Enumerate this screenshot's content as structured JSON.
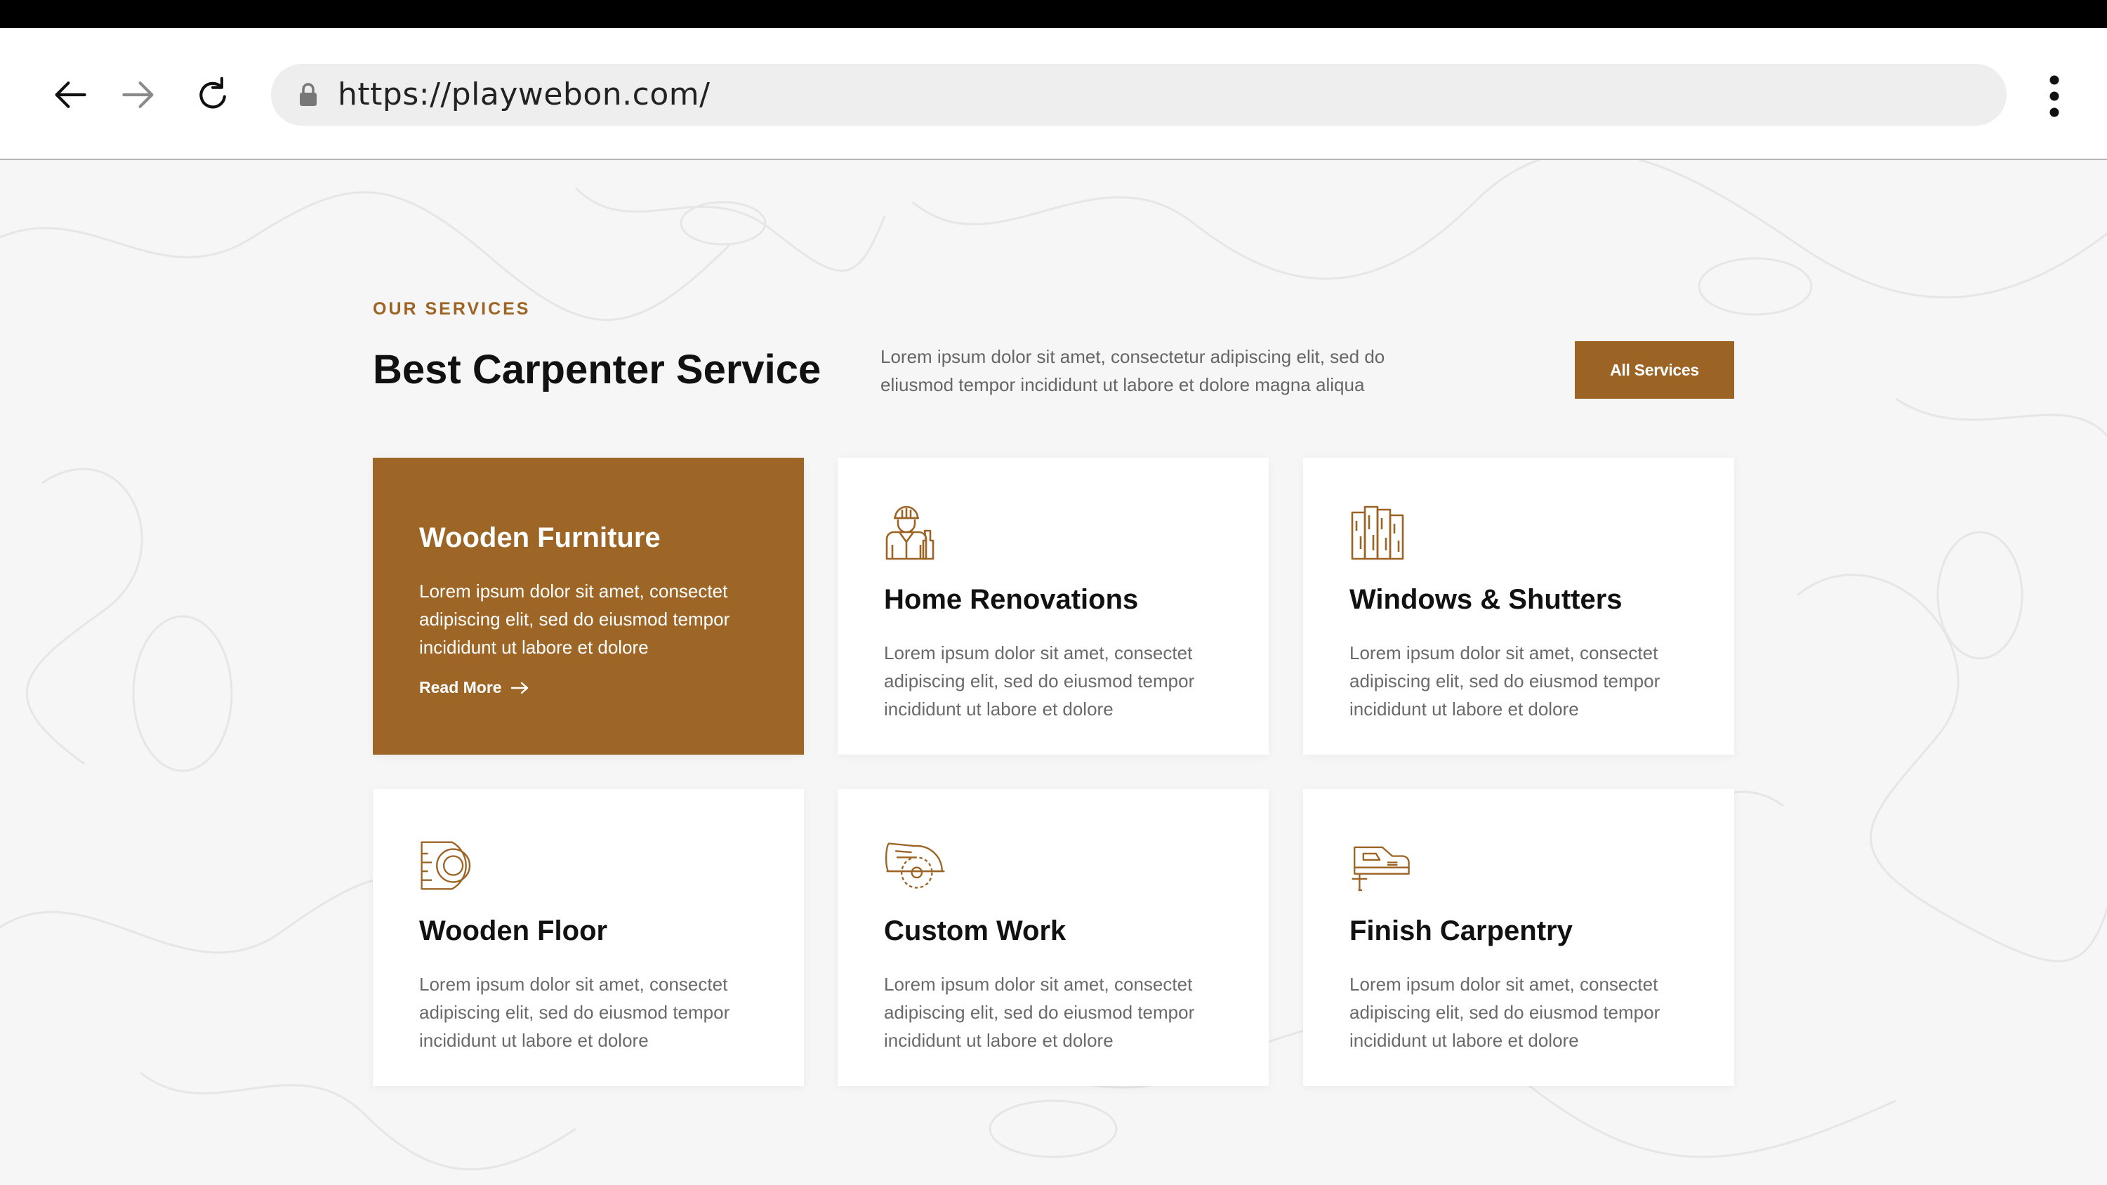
{
  "browser": {
    "url": "https://playwebon.com/"
  },
  "section": {
    "eyebrow": "OUR SERVICES",
    "heading": "Best Carpenter Service",
    "intro": "Lorem ipsum dolor sit amet, consectetur adipiscing elit, sed do eliusmod tempor incididunt ut labore et dolore magna aliqua",
    "button_label": "All Services"
  },
  "services": [
    {
      "title": "Wooden Furniture",
      "description": "Lorem ipsum dolor sit amet, consectet adipiscing elit, sed do eiusmod tempor incididunt ut labore et dolore",
      "link_label": "Read More",
      "highlighted": true
    },
    {
      "title": "Home Renovations",
      "description": "Lorem ipsum dolor sit amet, consectet adipiscing elit, sed do eiusmod tempor incididunt ut labore et dolore",
      "icon": "worker-icon"
    },
    {
      "title": "Windows & Shutters",
      "description": "Lorem ipsum dolor sit amet, consectet adipiscing elit, sed do eiusmod tempor incididunt ut labore et dolore",
      "icon": "wood-planks-icon"
    },
    {
      "title": "Wooden Floor",
      "description": "Lorem ipsum dolor sit amet, consectet adipiscing elit, sed do eiusmod tempor incididunt ut labore et dolore",
      "icon": "tape-measure-icon"
    },
    {
      "title": "Custom Work",
      "description": "Lorem ipsum dolor sit amet, consectet adipiscing elit, sed do eiusmod tempor incididunt ut labore et dolore",
      "icon": "circular-saw-icon"
    },
    {
      "title": "Finish Carpentry",
      "description": "Lorem ipsum dolor sit amet, consectet adipiscing elit, sed do eiusmod tempor incididunt ut labore et dolore",
      "icon": "jigsaw-icon"
    }
  ],
  "colors": {
    "accent": "#9c6424",
    "background": "#f6f6f6",
    "card": "#ffffff"
  }
}
